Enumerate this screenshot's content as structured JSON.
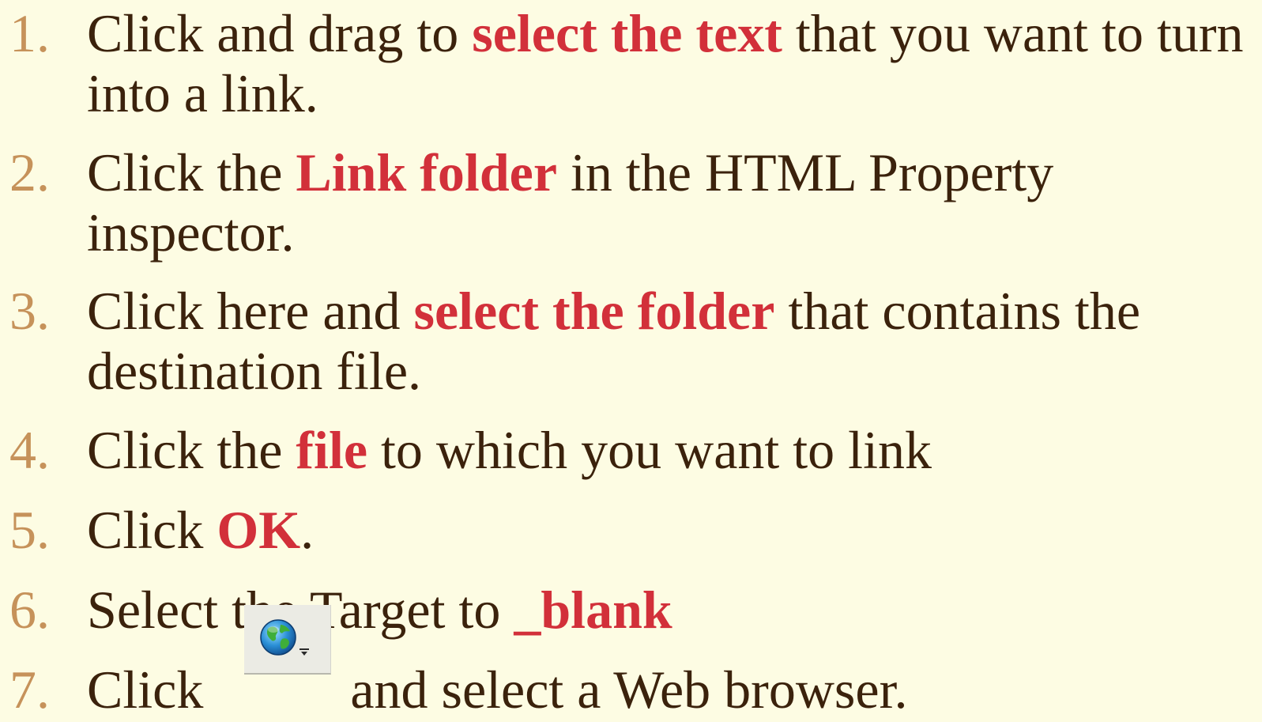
{
  "steps": [
    {
      "number": "1.",
      "before": "Click and drag to ",
      "highlight": "select the text",
      "after": " that you want to turn into a link."
    },
    {
      "number": "2.",
      "before": "Click the ",
      "highlight": "Link folder",
      "after": " in the HTML Property inspector."
    },
    {
      "number": "3.",
      "before": "Click here and ",
      "highlight": "select the folder",
      "after": " that contains the destination file."
    },
    {
      "number": "4.",
      "before": "Click the ",
      "highlight": "file",
      "after": " to which you want to link"
    },
    {
      "number": "5.",
      "before": "Click ",
      "highlight": "OK",
      "after": "."
    },
    {
      "number": "6.",
      "before": "Select the Target to ",
      "highlight": "_blank",
      "after": ""
    },
    {
      "number": "7.",
      "before": "Click",
      "gap": "          ",
      "after": "and select a Web browser."
    }
  ],
  "colors": {
    "background": "#fdfce3",
    "text": "#3b220c",
    "numbers": "#c6925a",
    "highlight": "#d2303a"
  },
  "preview_button": {
    "icon": "globe-preview-icon",
    "dropdown_icon": "small-caret-down-icon"
  }
}
